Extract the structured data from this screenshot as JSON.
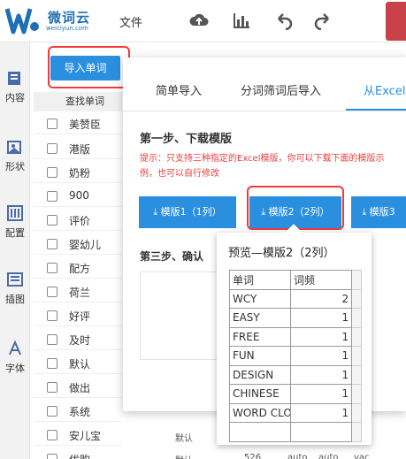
{
  "app": {
    "logo_text": "微词云",
    "logo_sub": "weiciyun.com",
    "menu_file": "文件"
  },
  "sidebar": {
    "items": [
      {
        "label": "内容",
        "icon": "content-icon"
      },
      {
        "label": "形状",
        "icon": "shape-icon"
      },
      {
        "label": "配置",
        "icon": "config-icon"
      },
      {
        "label": "插图",
        "icon": "illustration-icon"
      },
      {
        "label": "字体",
        "icon": "font-icon"
      }
    ]
  },
  "word_panel": {
    "import_label": "导入单词",
    "search_header": "查找单词",
    "words": [
      "美赞臣",
      "港版",
      "奶粉",
      "900",
      "评价",
      "婴幼儿",
      "配方",
      "荷兰",
      "好评",
      "及时",
      "默认",
      "做出",
      "系统",
      "安儿宝",
      "优购"
    ],
    "extra_col": [
      "默认",
      "默认"
    ],
    "extra_nums": [
      "526",
      "auto",
      "auto",
      "vac"
    ]
  },
  "modal": {
    "tabs": [
      {
        "label": "简单导入",
        "active": false
      },
      {
        "label": "分词筛词后导入",
        "active": false
      },
      {
        "label": "从Excel",
        "active": true
      }
    ],
    "step1_title": "第一步、下载模版",
    "hint": "提示：只支持三种指定的Excel模版，你可以下载下面的模版示例，也可以自行修改",
    "templates": [
      {
        "label": "模版1（1列）"
      },
      {
        "label": "模版2（2列）"
      },
      {
        "label": "模版3"
      }
    ],
    "step3_title": "第三步、确认"
  },
  "preview": {
    "title": "预览—模版2（2列）",
    "headers": [
      "单词",
      "词频"
    ],
    "rows": [
      {
        "word": "WCY",
        "freq": "2"
      },
      {
        "word": "EASY",
        "freq": "1"
      },
      {
        "word": "FREE",
        "freq": "1"
      },
      {
        "word": "FUN",
        "freq": "1"
      },
      {
        "word": "DESIGN",
        "freq": "1"
      },
      {
        "word": "CHINESE",
        "freq": "1"
      },
      {
        "word": "WORD CLO",
        "freq": "1"
      }
    ]
  },
  "colors": {
    "accent": "#2b8fe0",
    "hint_red": "#e8413c",
    "highlight_red": "#f23a3a"
  }
}
